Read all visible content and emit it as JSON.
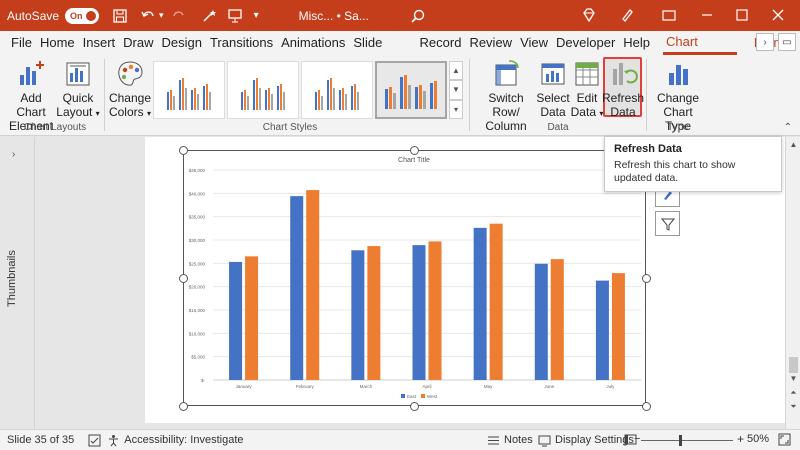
{
  "titlebar": {
    "autosave_label": "AutoSave",
    "autosave_state": "On",
    "doc_title": "Misc... • Sa...",
    "accent": "#c43e1c"
  },
  "tabs": [
    {
      "label": "File"
    },
    {
      "label": "Home"
    },
    {
      "label": "Insert"
    },
    {
      "label": "Draw"
    },
    {
      "label": "Design"
    },
    {
      "label": "Transitions"
    },
    {
      "label": "Animations"
    },
    {
      "label": "Slide Show"
    },
    {
      "label": "Record"
    },
    {
      "label": "Review"
    },
    {
      "label": "View"
    },
    {
      "label": "Developer"
    },
    {
      "label": "Help"
    }
  ],
  "active_tab": "Chart Design",
  "format_tab": "Format",
  "ribbon": {
    "add_chart_element": {
      "line1": "Add Chart",
      "line2": "Element"
    },
    "quick_layout": {
      "line1": "Quick",
      "line2": "Layout"
    },
    "chart_layouts_label": "Chart Layouts",
    "change_colors": {
      "line1": "Change",
      "line2": "Colors"
    },
    "chart_styles_label": "Chart Styles",
    "switch_row_col": {
      "line1": "Switch Row/",
      "line2": "Column"
    },
    "select_data": {
      "line1": "Select",
      "line2": "Data"
    },
    "edit_data": {
      "line1": "Edit",
      "line2": "Data"
    },
    "refresh_data": {
      "line1": "Refresh",
      "line2": "Data"
    },
    "data_label": "Data",
    "change_chart_type": {
      "line1": "Change",
      "line2": "Chart Type"
    },
    "type_label": "Type"
  },
  "tooltip": {
    "title": "Refresh Data",
    "description": "Refresh this chart to show updated data."
  },
  "thumbnails_label": "Thumbnails",
  "chart_data": {
    "type": "bar",
    "title": "Chart Title",
    "categories": [
      "January",
      "February",
      "March",
      "April",
      "May",
      "June",
      "July"
    ],
    "series": [
      {
        "name": "East",
        "color": "#4472c4",
        "values": [
          25300,
          39400,
          27800,
          28900,
          32600,
          24900,
          21300
        ]
      },
      {
        "name": "West",
        "color": "#ed7d31",
        "values": [
          26500,
          40700,
          28700,
          29700,
          33500,
          25900,
          22900
        ]
      }
    ],
    "y_ticks": [
      "$-",
      "$5,000",
      "$10,000",
      "$15,000",
      "$20,000",
      "$25,000",
      "$30,000",
      "$35,000",
      "$40,000",
      "$45,000"
    ],
    "ylim": [
      0,
      45000
    ],
    "grid": true,
    "legend": "bottom"
  },
  "statusbar": {
    "slide_info": "Slide 35 of 35",
    "accessibility": "Accessibility: Investigate",
    "notes": "Notes",
    "display_settings": "Display Settings",
    "zoom": "50%"
  }
}
